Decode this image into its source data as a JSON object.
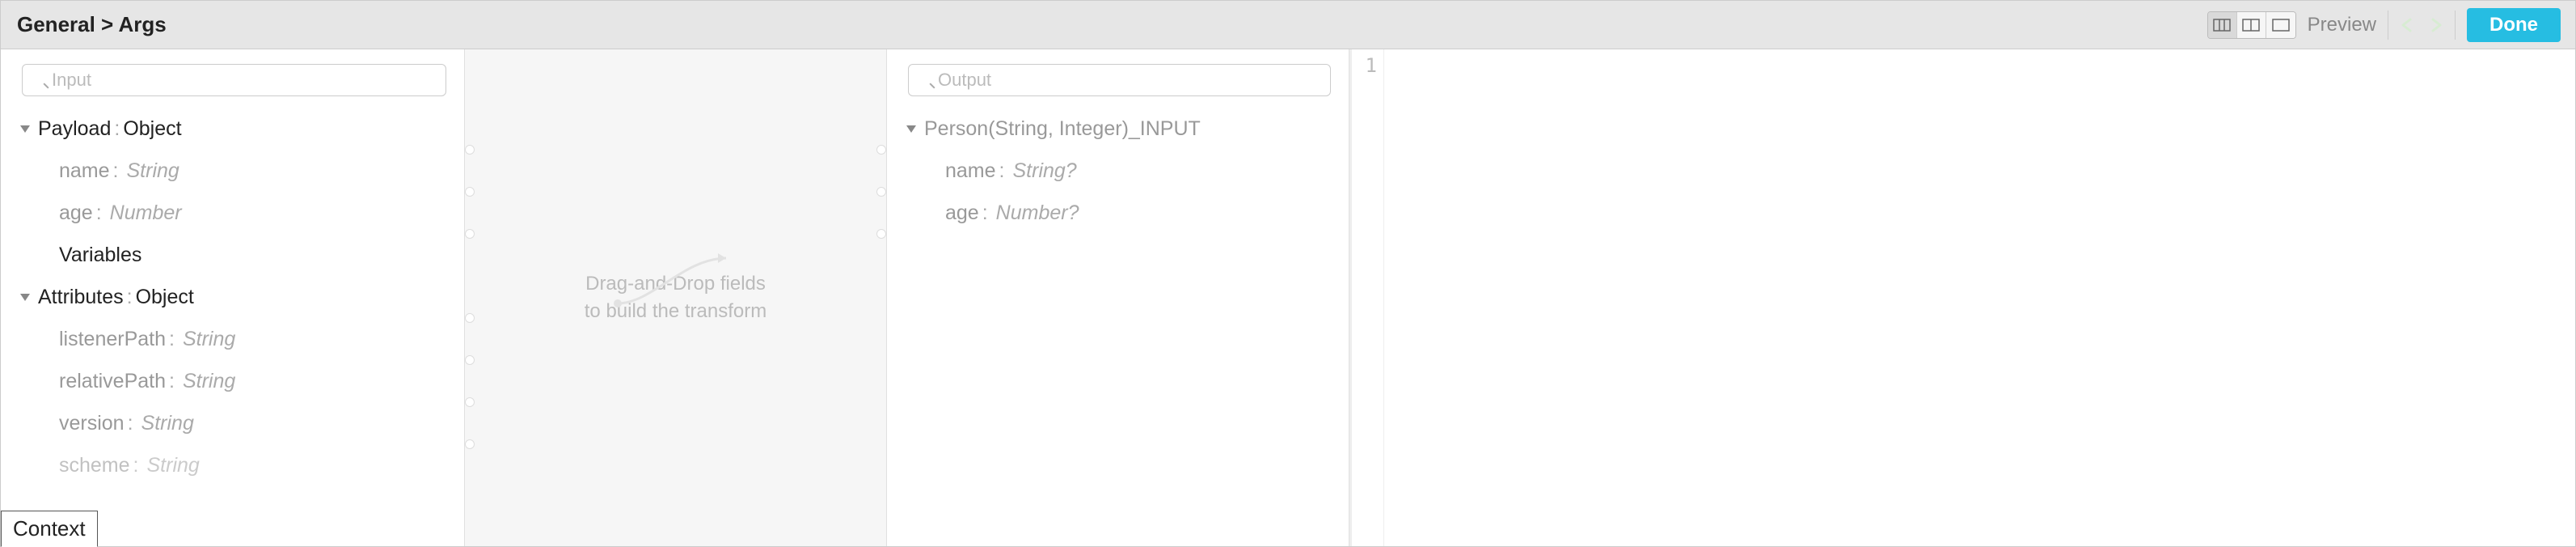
{
  "header": {
    "breadcrumb": "General > Args",
    "preview_label": "Preview",
    "done_label": "Done"
  },
  "input": {
    "search_placeholder": "Input",
    "tree": {
      "payload": {
        "label": "Payload",
        "type": "Object"
      },
      "payload_children": [
        {
          "name": "name",
          "type": "String"
        },
        {
          "name": "age",
          "type": "Number"
        }
      ],
      "variables": {
        "label": "Variables"
      },
      "attributes": {
        "label": "Attributes",
        "type": "Object"
      },
      "attributes_children": [
        {
          "name": "listenerPath",
          "type": "String"
        },
        {
          "name": "relativePath",
          "type": "String"
        },
        {
          "name": "version",
          "type": "String"
        },
        {
          "name": "scheme",
          "type": "String"
        }
      ]
    },
    "context_tab": "Context"
  },
  "mapping": {
    "hint_line1": "Drag-and-Drop fields",
    "hint_line2": "to build the transform"
  },
  "output": {
    "search_placeholder": "Output",
    "tree": {
      "root": {
        "label": "Person(String, Integer)_INPUT"
      },
      "children": [
        {
          "name": "name",
          "type": "String?"
        },
        {
          "name": "age",
          "type": "Number?"
        }
      ]
    }
  },
  "editor": {
    "line_numbers": [
      "1"
    ]
  },
  "colors": {
    "accent": "#26bde2",
    "header_bg": "#e6e6e6",
    "muted": "#aaaaaa"
  }
}
